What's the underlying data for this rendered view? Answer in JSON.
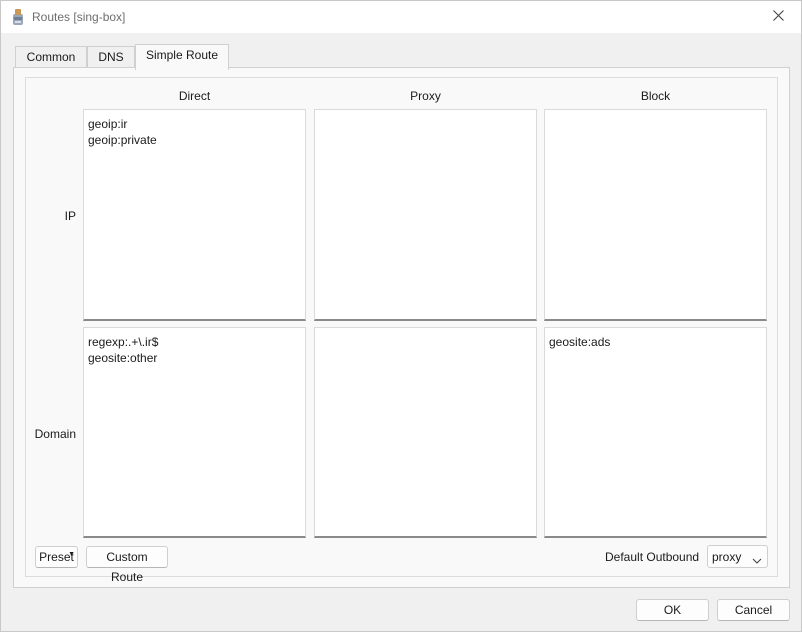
{
  "window": {
    "title": "Routes [sing-box]",
    "app_icon": "sing-box-app-icon",
    "close_icon": "close-icon"
  },
  "tabs": [
    {
      "label": "Common",
      "active": false
    },
    {
      "label": "DNS",
      "active": false
    },
    {
      "label": "Simple Route",
      "active": true
    }
  ],
  "columns": [
    "Direct",
    "Proxy",
    "Block"
  ],
  "rows": [
    {
      "label": "IP",
      "cells": [
        [
          "geoip:ir",
          "geoip:private"
        ],
        [],
        []
      ]
    },
    {
      "label": "Domain",
      "cells": [
        [
          "regexp:.+\\.ir$",
          "geosite:other"
        ],
        [],
        [
          "geosite:ads"
        ]
      ]
    }
  ],
  "buttons": {
    "preset": "Preset",
    "custom_route": "Custom Route",
    "ok": "OK",
    "cancel": "Cancel"
  },
  "default_outbound": {
    "label": "Default Outbound",
    "value": "proxy"
  },
  "colors": {
    "window_bg": "#f0f0f0",
    "panel_bg": "#f9f9f9",
    "textbox_bg": "#ffffff",
    "title_text": "#6e6e6e"
  }
}
